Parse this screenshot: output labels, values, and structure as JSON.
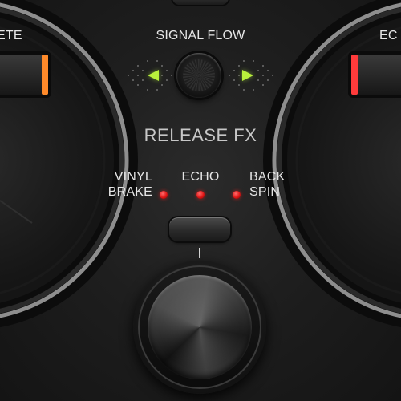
{
  "header": {
    "signal_flow_label": "SIGNAL FLOW",
    "deck_left_label_fragment": "ETE",
    "deck_right_label_fragment": "EC"
  },
  "release_fx": {
    "title": "RELEASE FX",
    "options": [
      {
        "label_line1": "VINYL",
        "label_line2": "BRAKE",
        "led_color": "#e01616"
      },
      {
        "label_line1": "ECHO",
        "label_line2": "",
        "led_color": "#e01616"
      },
      {
        "label_line1": "BACK",
        "label_line2": "SPIN",
        "led_color": "#e01616"
      }
    ]
  },
  "colors": {
    "arrow_indicator": "#b9f03c",
    "deck_left_pad_accent": "#ff8a2a",
    "deck_right_pad_accent": "#ff3b3b",
    "label_text": "#e6e6e6"
  }
}
